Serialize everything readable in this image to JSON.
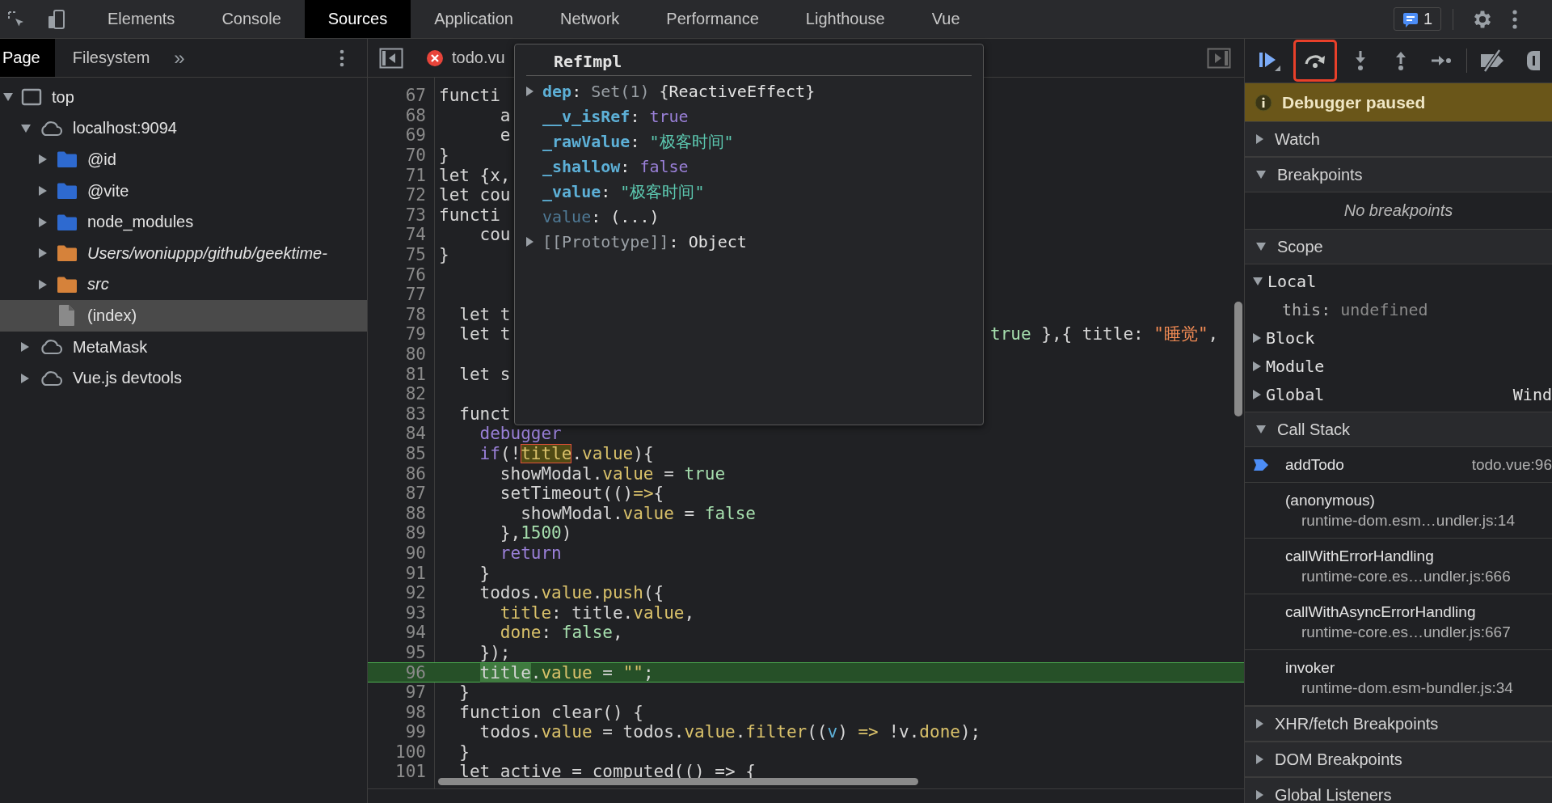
{
  "tabs": [
    {
      "label": "Elements",
      "selected": false
    },
    {
      "label": "Console",
      "selected": false
    },
    {
      "label": "Sources",
      "selected": true
    },
    {
      "label": "Application",
      "selected": false
    },
    {
      "label": "Network",
      "selected": false
    },
    {
      "label": "Performance",
      "selected": false
    },
    {
      "label": "Lighthouse",
      "selected": false
    },
    {
      "label": "Vue",
      "selected": false
    }
  ],
  "issues_badge": "1",
  "navigator": {
    "tabs": [
      {
        "label": "Page",
        "selected": true
      },
      {
        "label": "Filesystem",
        "selected": false
      }
    ],
    "more": "»",
    "tree": [
      {
        "label": "top",
        "kind": "frame",
        "expanded": true,
        "selected": false,
        "children": [
          {
            "label": "localhost:9094",
            "kind": "origin",
            "expanded": true,
            "selected": false,
            "children": [
              {
                "label": "@id",
                "kind": "folder",
                "expanded": false,
                "selected": false
              },
              {
                "label": "@vite",
                "kind": "folder",
                "expanded": false,
                "selected": false
              },
              {
                "label": "node_modules",
                "kind": "folder",
                "expanded": false,
                "selected": false
              },
              {
                "label": "Users/woniuppp/github/geektime-",
                "kind": "authored-folder",
                "expanded": false,
                "selected": false
              },
              {
                "label": "src",
                "kind": "authored-folder",
                "expanded": false,
                "selected": false
              },
              {
                "label": "(index)",
                "kind": "file",
                "selected": true
              }
            ]
          },
          {
            "label": "MetaMask",
            "kind": "origin",
            "expanded": false,
            "selected": false
          },
          {
            "label": "Vue.js devtools",
            "kind": "origin",
            "expanded": false,
            "selected": false
          }
        ]
      }
    ]
  },
  "editor": {
    "file_tab": {
      "label": "todo.vu",
      "error": true
    },
    "lines": [
      {
        "number": "67",
        "current": false,
        "tokens": [
          {
            "text": "functi",
            "kind": "plain"
          }
        ]
      },
      {
        "number": "68",
        "current": false,
        "tokens": [
          {
            "text": "      a",
            "kind": "plain"
          }
        ]
      },
      {
        "number": "69",
        "current": false,
        "tokens": [
          {
            "text": "      e",
            "kind": "plain"
          }
        ]
      },
      {
        "number": "70",
        "current": false,
        "tokens": [
          {
            "text": "}",
            "kind": "plain"
          }
        ]
      },
      {
        "number": "71",
        "current": false,
        "tokens": [
          {
            "text": "let {x,",
            "kind": "plain"
          }
        ]
      },
      {
        "number": "72",
        "current": false,
        "tokens": [
          {
            "text": "let cou",
            "kind": "plain"
          }
        ]
      },
      {
        "number": "73",
        "current": false,
        "tokens": [
          {
            "text": "functi",
            "kind": "plain"
          }
        ]
      },
      {
        "number": "74",
        "current": false,
        "tokens": [
          {
            "text": "    cou",
            "kind": "plain"
          }
        ]
      },
      {
        "number": "75",
        "current": false,
        "tokens": [
          {
            "text": "}",
            "kind": "plain"
          }
        ]
      },
      {
        "number": "76",
        "current": false
      },
      {
        "number": "77",
        "current": false
      },
      {
        "number": "78",
        "current": false,
        "tokens": [
          {
            "text": "  let t",
            "kind": "plain"
          }
        ]
      },
      {
        "number": "79",
        "current": false,
        "tokens": [
          {
            "text": "  let t",
            "kind": "plain"
          }
        ],
        "tail": [
          {
            "text": "true",
            "kind": "literal"
          },
          {
            "text": " },{ title: ",
            "kind": "plain"
          },
          {
            "text": "\"睡觉\"",
            "kind": "string"
          },
          {
            "text": ",",
            "kind": "plain"
          }
        ]
      },
      {
        "number": "80",
        "current": false
      },
      {
        "number": "81",
        "current": false,
        "tokens": [
          {
            "text": "  let s",
            "kind": "plain"
          }
        ]
      },
      {
        "number": "82",
        "current": false
      },
      {
        "number": "83",
        "current": false,
        "tokens": [
          {
            "text": "  funct",
            "kind": "plain"
          }
        ]
      },
      {
        "number": "84",
        "current": false,
        "tokens": [
          {
            "text": "    debugger",
            "kind": "keyword"
          }
        ]
      },
      {
        "number": "85",
        "current": false,
        "tokens": [
          {
            "text": "    if",
            "kind": "keyword"
          },
          {
            "text": "(!",
            "kind": "plain"
          },
          {
            "text": "title",
            "kind": "hovered"
          },
          {
            "text": ".",
            "kind": "plain"
          },
          {
            "text": "value",
            "kind": "property"
          },
          {
            "text": "){",
            "kind": "plain"
          }
        ]
      },
      {
        "number": "86",
        "current": false,
        "tokens": [
          {
            "text": "      showModal.",
            "kind": "plain"
          },
          {
            "text": "value",
            "kind": "property"
          },
          {
            "text": " = ",
            "kind": "plain"
          },
          {
            "text": "true",
            "kind": "literal"
          }
        ]
      },
      {
        "number": "87",
        "current": false,
        "tokens": [
          {
            "text": "      setTimeout(()",
            "kind": "plain"
          },
          {
            "text": "=>",
            "kind": "property"
          },
          {
            "text": "{",
            "kind": "plain"
          }
        ]
      },
      {
        "number": "88",
        "current": false,
        "tokens": [
          {
            "text": "        showModal.",
            "kind": "plain"
          },
          {
            "text": "value",
            "kind": "property"
          },
          {
            "text": " = ",
            "kind": "plain"
          },
          {
            "text": "false",
            "kind": "literal"
          }
        ]
      },
      {
        "number": "89",
        "current": false,
        "tokens": [
          {
            "text": "      },",
            "kind": "plain"
          },
          {
            "text": "1500",
            "kind": "literal"
          },
          {
            "text": ")",
            "kind": "plain"
          }
        ]
      },
      {
        "number": "90",
        "current": false,
        "tokens": [
          {
            "text": "      return",
            "kind": "keyword"
          }
        ]
      },
      {
        "number": "91",
        "current": false,
        "tokens": [
          {
            "text": "    }",
            "kind": "plain"
          }
        ]
      },
      {
        "number": "92",
        "current": false,
        "tokens": [
          {
            "text": "    todos.",
            "kind": "plain"
          },
          {
            "text": "value",
            "kind": "property"
          },
          {
            "text": ".",
            "kind": "plain"
          },
          {
            "text": "push",
            "kind": "property"
          },
          {
            "text": "({",
            "kind": "plain"
          }
        ]
      },
      {
        "number": "93",
        "current": false,
        "tokens": [
          {
            "text": "      title",
            "kind": "property"
          },
          {
            "text": ": title.",
            "kind": "plain"
          },
          {
            "text": "value",
            "kind": "property"
          },
          {
            "text": ",",
            "kind": "plain"
          }
        ]
      },
      {
        "number": "94",
        "current": false,
        "tokens": [
          {
            "text": "      done",
            "kind": "property"
          },
          {
            "text": ": ",
            "kind": "plain"
          },
          {
            "text": "false",
            "kind": "literal"
          },
          {
            "text": ",",
            "kind": "plain"
          }
        ]
      },
      {
        "number": "95",
        "current": false,
        "tokens": [
          {
            "text": "    });",
            "kind": "plain"
          }
        ]
      },
      {
        "number": "96",
        "current": true,
        "tokens": [
          {
            "text": "    title",
            "kind": "execution"
          },
          {
            "text": ".",
            "kind": "plain"
          },
          {
            "text": "value",
            "kind": "property"
          },
          {
            "text": " = ",
            "kind": "plain"
          },
          {
            "text": "\"\"",
            "kind": "property"
          },
          {
            "text": ";",
            "kind": "plain"
          }
        ]
      },
      {
        "number": "97",
        "current": false,
        "tokens": [
          {
            "text": "  }",
            "kind": "plain"
          }
        ]
      },
      {
        "number": "98",
        "current": false,
        "tokens": [
          {
            "text": "  function clear() {",
            "kind": "plain"
          }
        ]
      },
      {
        "number": "99",
        "current": false,
        "tokens": [
          {
            "text": "    todos.",
            "kind": "plain"
          },
          {
            "text": "value",
            "kind": "property"
          },
          {
            "text": " = todos.",
            "kind": "plain"
          },
          {
            "text": "value",
            "kind": "property"
          },
          {
            "text": ".",
            "kind": "plain"
          },
          {
            "text": "filter",
            "kind": "property"
          },
          {
            "text": "((",
            "kind": "plain"
          },
          {
            "text": "v",
            "kind": "parameter"
          },
          {
            "text": ") ",
            "kind": "plain"
          },
          {
            "text": "=>",
            "kind": "property"
          },
          {
            "text": " !v.",
            "kind": "plain"
          },
          {
            "text": "done",
            "kind": "property"
          },
          {
            "text": ");",
            "kind": "plain"
          }
        ]
      },
      {
        "number": "100",
        "current": false,
        "tokens": [
          {
            "text": "  }",
            "kind": "plain"
          }
        ]
      },
      {
        "number": "101",
        "current": false,
        "tokens": [
          {
            "text": "  let active = computed(() => {",
            "kind": "plain"
          }
        ]
      }
    ],
    "popover": {
      "title": "RefImpl",
      "properties": [
        {
          "expandable": true,
          "key": "dep",
          "kind": "own",
          "value": [
            {
              "text": ": ",
              "kind": "plain"
            },
            {
              "text": "Set(1)",
              "kind": "dim"
            },
            {
              "text": " {ReactiveEffect}",
              "kind": "plain"
            }
          ]
        },
        {
          "expandable": false,
          "key": "__v_isRef",
          "kind": "own",
          "value": [
            {
              "text": ": ",
              "kind": "plain"
            },
            {
              "text": "true",
              "kind": "keyword"
            }
          ]
        },
        {
          "expandable": false,
          "key": "_rawValue",
          "kind": "own",
          "value": [
            {
              "text": ": ",
              "kind": "plain"
            },
            {
              "text": "\"极客时间\"",
              "kind": "string"
            }
          ]
        },
        {
          "expandable": false,
          "key": "_shallow",
          "kind": "own",
          "value": [
            {
              "text": ": ",
              "kind": "plain"
            },
            {
              "text": "false",
              "kind": "keyword"
            }
          ]
        },
        {
          "expandable": false,
          "key": "_value",
          "kind": "own",
          "value": [
            {
              "text": ": ",
              "kind": "plain"
            },
            {
              "text": "\"极客时间\"",
              "kind": "string"
            }
          ]
        },
        {
          "expandable": false,
          "key": "value",
          "kind": "accessor",
          "value": [
            {
              "text": ": (...)",
              "kind": "plain"
            }
          ]
        },
        {
          "expandable": true,
          "key": "[[Prototype]]",
          "kind": "internal",
          "value": [
            {
              "text": ": Object",
              "kind": "plain"
            }
          ]
        }
      ]
    }
  },
  "debugger": {
    "toolbar": [
      {
        "kind": "resume",
        "highlighted": false
      },
      {
        "kind": "step-over",
        "highlighted": true
      },
      {
        "kind": "step-into",
        "highlighted": false
      },
      {
        "kind": "step-out",
        "highlighted": false
      },
      {
        "kind": "step",
        "highlighted": false
      },
      {
        "kind": "deactivate",
        "highlighted": false
      },
      {
        "kind": "pause-exceptions",
        "highlighted": false
      }
    ],
    "banner": "Debugger paused",
    "sections": [
      {
        "title": "Watch",
        "expanded": false
      },
      {
        "title": "Breakpoints",
        "expanded": true,
        "empty_text": "No breakpoints"
      },
      {
        "title": "Scope",
        "expanded": true,
        "scopes": [
          {
            "name": "Local",
            "expanded": true,
            "vars": [
              {
                "name": "this:",
                "value": "undefined"
              }
            ]
          },
          {
            "name": "Block",
            "expanded": false
          },
          {
            "name": "Module",
            "expanded": false
          },
          {
            "name": "Global",
            "expanded": false,
            "value": "Wind"
          }
        ]
      },
      {
        "title": "Call Stack",
        "expanded": true,
        "frames": [
          {
            "name": "addTodo",
            "location": "todo.vue:96",
            "selected": true
          },
          {
            "name": "(anonymous)",
            "location": "runtime-dom.esm…undler.js:14",
            "selected": false
          },
          {
            "name": "callWithErrorHandling",
            "location": "runtime-core.es…undler.js:666",
            "selected": false
          },
          {
            "name": "callWithAsyncErrorHandling",
            "location": "runtime-core.es…undler.js:667",
            "selected": false
          },
          {
            "name": "invoker",
            "location": "runtime-dom.esm-bundler.js:34",
            "selected": false
          }
        ]
      },
      {
        "title": "XHR/fetch Breakpoints",
        "expanded": false
      },
      {
        "title": "DOM Breakpoints",
        "expanded": false
      },
      {
        "title": "Global Listeners",
        "expanded": false
      }
    ]
  }
}
